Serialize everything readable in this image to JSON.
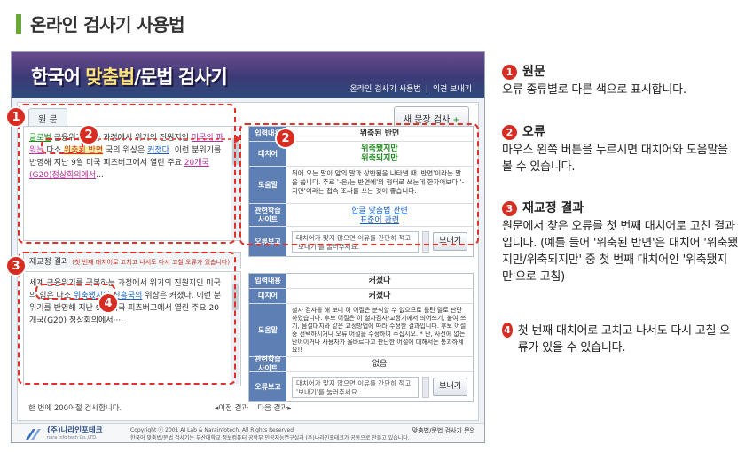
{
  "page": {
    "title": "온라인 검사기 사용법"
  },
  "app": {
    "logo_title_a": "한국어 ",
    "logo_title_b": "맞춤법",
    "logo_title_c": "/문법 검사기",
    "header_links": [
      "온라인 검사기 사용법",
      "의견 보내기"
    ]
  },
  "source": {
    "tab_label": "원 문",
    "new_sentence_button": "새 문장 검사",
    "text_parts": [
      "글로벌",
      " 금융위기를 ",
      "",
      "는 과정에서 위기의 진원지인 ",
      "미국의 파워는",
      " 다소 ",
      "위축된 반면",
      " ",
      "",
      "국의 위상은 ",
      "커졌다",
      ". 이런 분위기를 반영해 지난 9월 미국 피츠버그에서 열린 주요 ",
      "20개국(G20)정상회의에서",
      "..."
    ]
  },
  "correction": {
    "heading": "재교정 결과",
    "note": "(첫 번째 대치어로 고치고 나서도 다시 고칠 오류가 있습니다)",
    "text_before": "세계 금융위기를 극복하는 과정에서 위기의 진원지인 미국의 힘은 다소 ",
    "fixed": "위축됐지만 신흥국의",
    "text_after": " 위상은 커졌다. 이런 분위기를 반영해 지난 9월 미국 피츠버그에서 열린 주요 20개국(G20) 정상회의에서···."
  },
  "panel_a": {
    "input_label": "입력내용",
    "input_value": "위축된 반면",
    "replace_label": "대치어",
    "replace_value_1": "위축됐지만",
    "replace_value_2": "위축되지만",
    "help_label": "도움말",
    "help_value": "뒤에 오는 말이 앞의 말과 상반됨을 나타낼 때 '반면'이라는 말을 씁니다. 주로 '-은/는 반면에'의 형태로 쓰는데 한자어보다 '-지만'이라는 접속 조사를 쓰는 것이 좋습니다.",
    "study_label": "관련학습 사이트",
    "study_link_1": "한글 맞춤법 관련",
    "study_link_2": "표준어 관련",
    "report_label": "오류보고",
    "report_placeholder": "대치어가 맞지 않으면 이유를 간단히 적고 '보내기'를 눌러주세요.",
    "send_button": "보내기"
  },
  "panel_b": {
    "input_label": "입력내용",
    "input_value": "커졌다",
    "replace_label": "대치어",
    "replace_value": "커졌다",
    "help_label": "도움말",
    "help_value": "철자 검사를 해 보니 이 어절은 분석할 수 없으므로 틀린 말로 판단하였습니다. 후보 어절은 이 철자검사/교정기에서 띄어쓰기, 붙여 쓰기, 음절대치와 같은 교정방법에 따라 수정한 결과입니다. 후보 어절 중 선택하시거나 오류 어절을 수정하여 주십시오. * 단, 사전에 없는 단어이거나 사용자가 옳바르다고 판단한 어절에 대해서는 통과하세요!!",
    "study_label": "관련학습 사이트",
    "study_value": "없음",
    "report_label": "오류보고",
    "report_placeholder": "대치어가 맞지 않으면 이유를 간단히 적고 '보내기'를 눌러주세요.",
    "send_button": "보내기"
  },
  "inner_footer": {
    "count_text": "한 번에 200어절 검사합니다.",
    "prev": "◂이전 결과",
    "next": "다음 결과▸"
  },
  "footer": {
    "company_name": "(주)나라인포테크",
    "company_en": "nara info tech Co.,LTD.",
    "copyright_1": "Copyright ⓒ 2001 AI Lab & Narainfotech. All Rights Reserved",
    "copyright_2": "한국어 맞춤법/문법 검사기는 부산대학교 정보컴퓨터 공학부 인공지능연구실과 (주)나라인포테크가 공동으로 만들고 있습니다.",
    "contact": "맞춤법/문법 검사기 문의"
  },
  "callouts": {
    "1": "1",
    "2": "2",
    "3": "3",
    "4": "4"
  },
  "explanations": [
    {
      "num": "1",
      "title": "원문",
      "body": "오류 종류별로 다른 색으로 표시합니다."
    },
    {
      "num": "2",
      "title": "오류",
      "body": "마우스 왼쪽 버튼을 누르시면 대치어와 도움말을 볼 수 있습니다."
    },
    {
      "num": "3",
      "title": "재교정 결과",
      "body": "원문에서 찾은 오류를 첫 번째 대치어로 고친 결과입니다. (예를 들어 '위축된 반면'은 대치어 '위축됐지만/위축되지만' 중 첫 번째 대치어인 '위축됐지만'으로 고침)"
    },
    {
      "num": "4",
      "title": "",
      "body": "첫 번째 대치어로 고치고 나서도 다시 고칠 오류가 있을 수 있습니다."
    }
  ],
  "colors": {
    "accent_green": "#6aa83a",
    "callout_red": "#d62c22",
    "label_blue": "#5d7fb3"
  }
}
